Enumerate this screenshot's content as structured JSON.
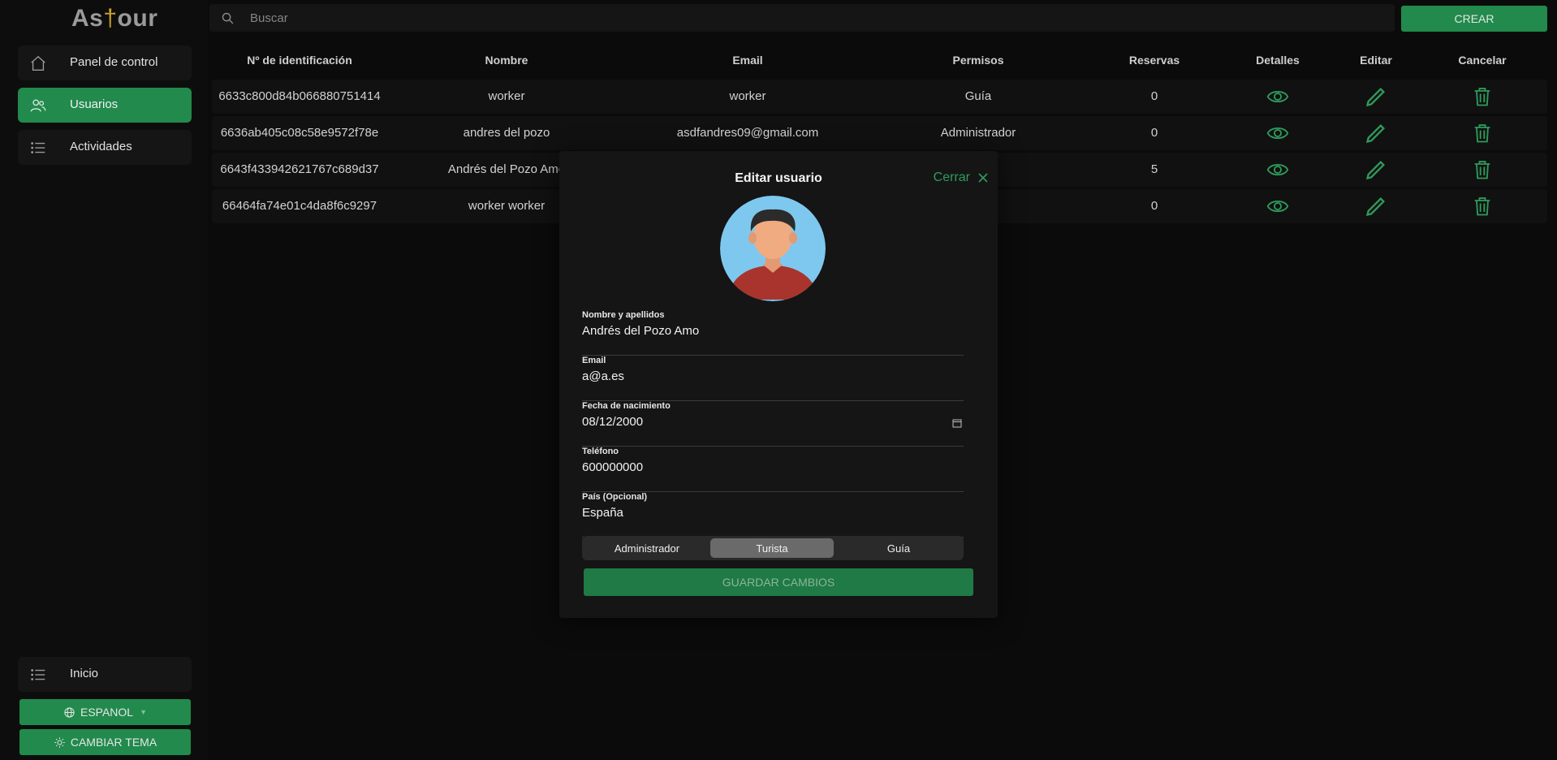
{
  "app": {
    "logo_left": "As",
    "logo_cross": "†",
    "logo_right": "our"
  },
  "sidebar": {
    "items": [
      {
        "label": "Panel de control",
        "icon": "home-icon"
      },
      {
        "label": "Usuarios",
        "icon": "users-icon",
        "active": true
      },
      {
        "label": "Actividades",
        "icon": "list-icon"
      }
    ],
    "bottom_item": {
      "label": "Inicio",
      "icon": "list-icon"
    },
    "language_button": "ESPANOL",
    "theme_button": "CAMBIAR TEMA"
  },
  "search": {
    "placeholder": "Buscar"
  },
  "create_button": "CREAR",
  "table": {
    "headers": [
      "Nº de identificación",
      "Nombre",
      "Email",
      "Permisos",
      "Reservas",
      "Detalles",
      "Editar",
      "Cancelar"
    ],
    "rows": [
      {
        "id": "6633c800d84b066880751414",
        "name": "worker",
        "email": "worker",
        "role": "Guía",
        "bookings": "0"
      },
      {
        "id": "6636ab405c08c58e9572f78e",
        "name": "andres del pozo",
        "email": "asdfandres09@gmail.com",
        "role": "Administrador",
        "bookings": "0"
      },
      {
        "id": "6643f433942621767c689d37",
        "name": "Andrés del Pozo Amo",
        "email": "",
        "role": "",
        "bookings": "5"
      },
      {
        "id": "66464fa74e01c4da8f6c9297",
        "name": "worker worker",
        "email": "",
        "role": "",
        "bookings": "0"
      }
    ]
  },
  "modal": {
    "title": "Editar usuario",
    "close_label": "Cerrar",
    "fields": [
      {
        "label": "Nombre y apellidos",
        "value": "Andrés del Pozo Amo"
      },
      {
        "label": "Email",
        "value": "a@a.es"
      },
      {
        "label": "Fecha de nacimiento",
        "value": "08/12/2000"
      },
      {
        "label": "Teléfono",
        "value": "600000000"
      },
      {
        "label": "País (Opcional)",
        "value": "España"
      }
    ],
    "roles": [
      "Administrador",
      "Turista",
      "Guía"
    ],
    "selected_role": "Turista",
    "save_button": "GUARDAR CAMBIOS"
  },
  "colors": {
    "accent": "#218a4c",
    "background": "#0b0b0b",
    "panel": "#151515"
  }
}
